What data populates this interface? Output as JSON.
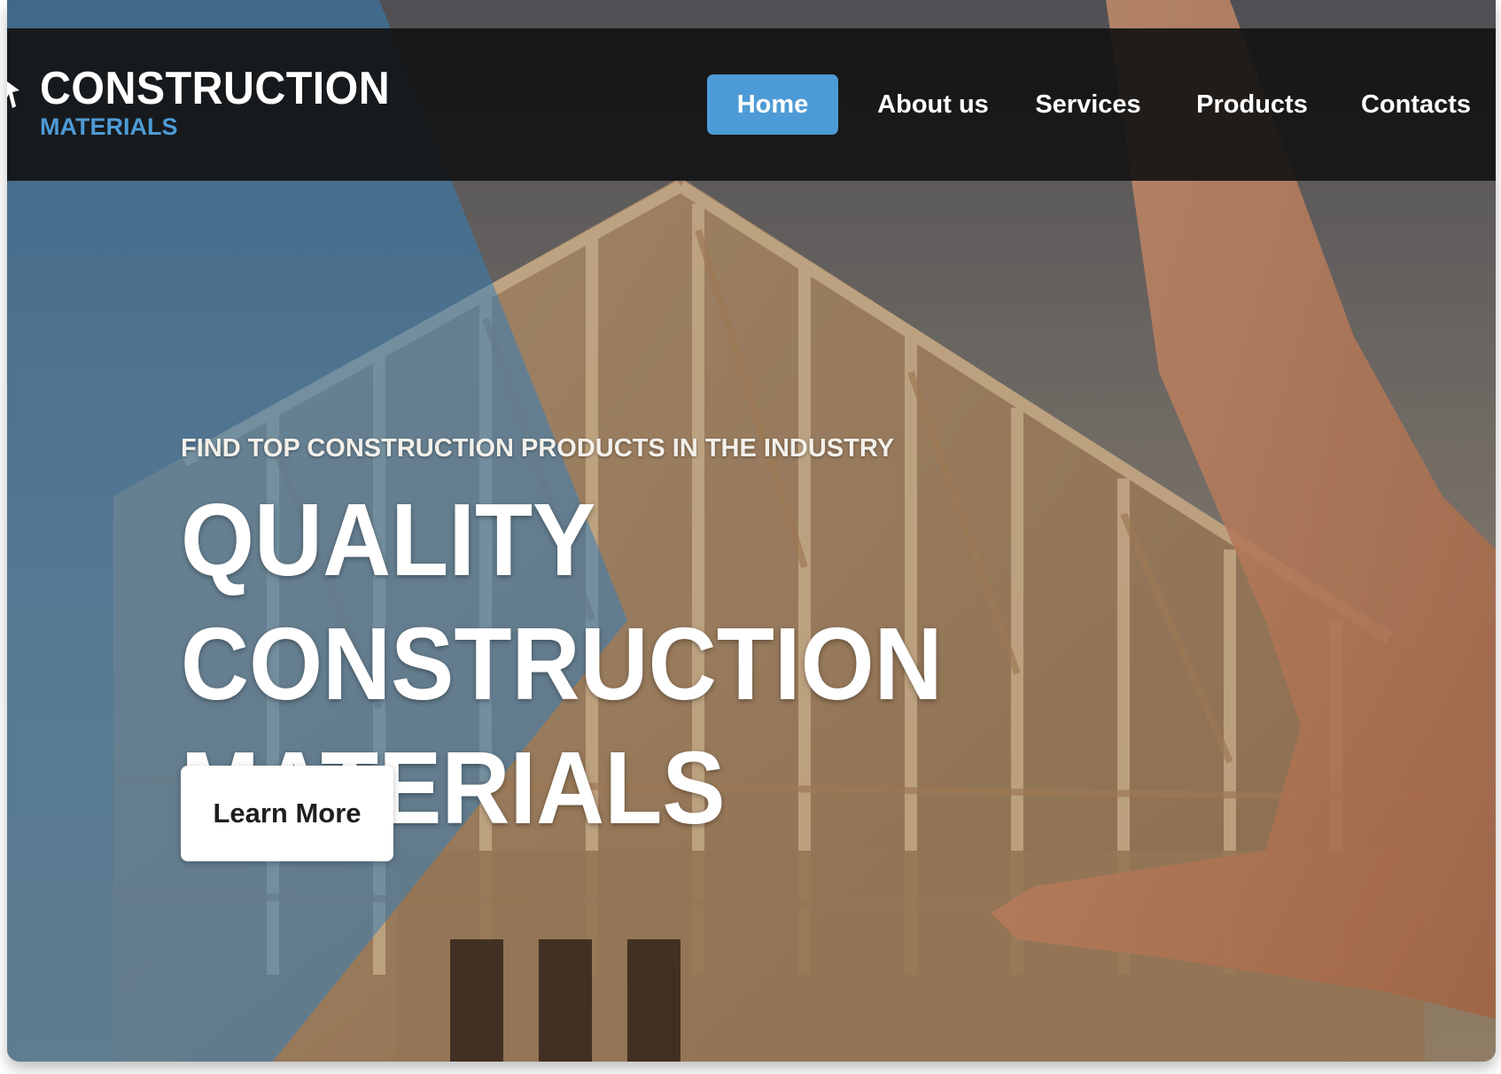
{
  "brand": {
    "title": "CONSTRUCTION",
    "subtitle": "MATERIALS",
    "accent_color": "#4d9bd6"
  },
  "nav": {
    "items": [
      {
        "label": "Home",
        "active": true
      },
      {
        "label": "About us",
        "active": false
      },
      {
        "label": "Services",
        "active": false
      },
      {
        "label": "Products",
        "active": false
      },
      {
        "label": "Contacts",
        "active": false
      }
    ]
  },
  "hero": {
    "tagline": "FIND TOP CONSTRUCTION PRODUCTS IN THE INDUSTRY",
    "title": "QUALITY CONSTRUCTION\nMATERIALS",
    "cta_label": "Learn More",
    "background_image": "wooden house frame under construction with hand framing gesture"
  }
}
